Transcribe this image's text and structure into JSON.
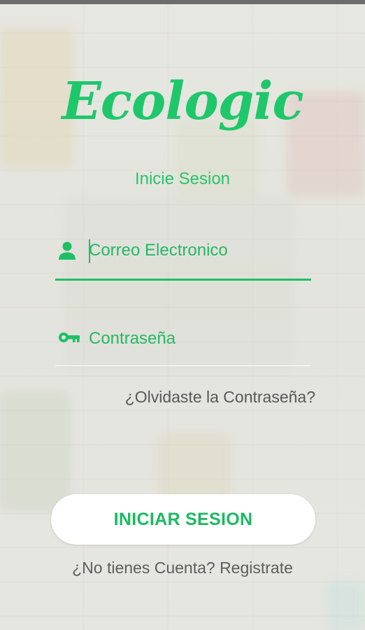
{
  "app": {
    "logo_text": "Ecologic",
    "subtitle": "Inicie Sesion"
  },
  "form": {
    "email": {
      "placeholder": "Correo Electronico",
      "value": "",
      "icon": "person-icon"
    },
    "password": {
      "placeholder": "Contraseña",
      "value": "",
      "icon": "key-icon"
    },
    "forgot_label": "¿Olvidaste la Contraseña?",
    "login_label": "INICIAR SESION",
    "signup_label": "¿No tienes Cuenta? Registrate"
  },
  "colors": {
    "accent": "#1fc76b",
    "button_bg": "#ffffff",
    "text_muted": "#5b5f5b"
  }
}
